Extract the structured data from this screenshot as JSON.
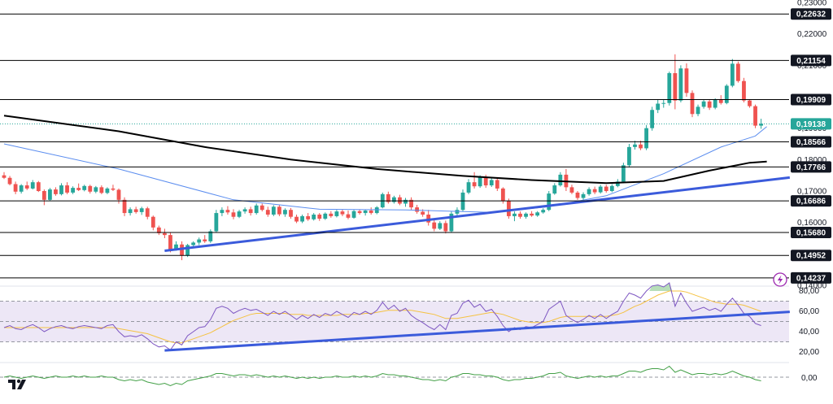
{
  "colors": {
    "up": "#26a69a",
    "down": "#ef5350",
    "ma_fast": "#5b8def",
    "ma_slow": "#000000",
    "trendline": "#3b5bdb",
    "rsi": "#7e57c2",
    "rsi_ma": "#f5c242",
    "rsi_band": "#ede7f6",
    "momentum": "#43a047",
    "level_line": "#000000",
    "price_tag": "#26a69a"
  },
  "price_axis_ticks": [
    "0,23000",
    "0,22000",
    "0,21000",
    "0,20000",
    "0,19000",
    "0,18000",
    "0,17000",
    "0,16000",
    "0,15000",
    "0,14000"
  ],
  "levels": [
    "0,22632",
    "0,21154",
    "0,19909",
    "0,18566",
    "0,17766",
    "0,16686",
    "0,15680",
    "0,14952",
    "0,14237"
  ],
  "current_price": "0,19138",
  "rsi_axis_ticks": [
    "80,00",
    "60,00",
    "40,00",
    "20,00"
  ],
  "momentum_axis_ticks": [
    "0,00"
  ],
  "icons": {
    "logo": "tradingview-logo-icon",
    "alert": "lightning-icon"
  },
  "chart_data": {
    "type": "candlestick",
    "ylim": [
      0.14,
      0.23
    ],
    "candles": [
      [
        0.175,
        0.176,
        0.1738,
        0.1742
      ],
      [
        0.1742,
        0.1748,
        0.1718,
        0.1722
      ],
      [
        0.1722,
        0.173,
        0.169,
        0.1698
      ],
      [
        0.1698,
        0.1722,
        0.1692,
        0.1718
      ],
      [
        0.1718,
        0.173,
        0.1703,
        0.1708
      ],
      [
        0.1708,
        0.1735,
        0.1705,
        0.1728
      ],
      [
        0.1728,
        0.1732,
        0.1697,
        0.17
      ],
      [
        0.17,
        0.1705,
        0.1655,
        0.1672
      ],
      [
        0.1672,
        0.171,
        0.1668,
        0.1705
      ],
      [
        0.1705,
        0.1712,
        0.1685,
        0.169
      ],
      [
        0.169,
        0.1725,
        0.1686,
        0.1718
      ],
      [
        0.1718,
        0.1728,
        0.169,
        0.1695
      ],
      [
        0.1695,
        0.1715,
        0.169,
        0.171
      ],
      [
        0.171,
        0.1724,
        0.17,
        0.1703
      ],
      [
        0.1703,
        0.172,
        0.1699,
        0.1716
      ],
      [
        0.1716,
        0.172,
        0.1692,
        0.1698
      ],
      [
        0.1698,
        0.1716,
        0.1693,
        0.1712
      ],
      [
        0.1712,
        0.1718,
        0.169,
        0.1694
      ],
      [
        0.1694,
        0.1712,
        0.169,
        0.1708
      ],
      [
        0.1708,
        0.172,
        0.17,
        0.1704
      ],
      [
        0.1704,
        0.1708,
        0.166,
        0.1672
      ],
      [
        0.1672,
        0.168,
        0.162,
        0.163
      ],
      [
        0.163,
        0.1648,
        0.1622,
        0.1642
      ],
      [
        0.1642,
        0.165,
        0.1628,
        0.1633
      ],
      [
        0.1633,
        0.165,
        0.1624,
        0.1645
      ],
      [
        0.1645,
        0.165,
        0.161,
        0.1618
      ],
      [
        0.1618,
        0.1622,
        0.1575,
        0.1584
      ],
      [
        0.1584,
        0.159,
        0.156,
        0.1566
      ],
      [
        0.1566,
        0.158,
        0.155,
        0.156
      ],
      [
        0.156,
        0.1568,
        0.1505,
        0.1515
      ],
      [
        0.1515,
        0.154,
        0.151,
        0.153
      ],
      [
        0.153,
        0.154,
        0.148,
        0.1495
      ],
      [
        0.1495,
        0.1532,
        0.149,
        0.1528
      ],
      [
        0.1528,
        0.154,
        0.152,
        0.1536
      ],
      [
        0.1536,
        0.1552,
        0.1528,
        0.1546
      ],
      [
        0.1546,
        0.156,
        0.1535,
        0.154
      ],
      [
        0.154,
        0.1578,
        0.1535,
        0.1572
      ],
      [
        0.1572,
        0.164,
        0.1568,
        0.163
      ],
      [
        0.163,
        0.1648,
        0.162,
        0.164
      ],
      [
        0.164,
        0.1652,
        0.1625,
        0.1632
      ],
      [
        0.1632,
        0.1642,
        0.161,
        0.1618
      ],
      [
        0.1618,
        0.164,
        0.1614,
        0.1635
      ],
      [
        0.1635,
        0.1648,
        0.1628,
        0.1642
      ],
      [
        0.1642,
        0.165,
        0.1622,
        0.163
      ],
      [
        0.163,
        0.166,
        0.1625,
        0.1654
      ],
      [
        0.1654,
        0.166,
        0.1635,
        0.164
      ],
      [
        0.164,
        0.165,
        0.1618,
        0.1625
      ],
      [
        0.1625,
        0.1655,
        0.162,
        0.165
      ],
      [
        0.165,
        0.1655,
        0.162,
        0.1626
      ],
      [
        0.1626,
        0.1645,
        0.1618,
        0.164
      ],
      [
        0.164,
        0.1646,
        0.1612,
        0.1618
      ],
      [
        0.1618,
        0.1625,
        0.1598,
        0.1603
      ],
      [
        0.1603,
        0.1625,
        0.1598,
        0.162
      ],
      [
        0.162,
        0.163,
        0.1605,
        0.161
      ],
      [
        0.161,
        0.163,
        0.1606,
        0.1625
      ],
      [
        0.1625,
        0.163,
        0.1605,
        0.1612
      ],
      [
        0.1612,
        0.1632,
        0.1608,
        0.1628
      ],
      [
        0.1628,
        0.1636,
        0.1615,
        0.162
      ],
      [
        0.162,
        0.164,
        0.1616,
        0.1635
      ],
      [
        0.1635,
        0.1642,
        0.162,
        0.1626
      ],
      [
        0.1626,
        0.1638,
        0.161,
        0.1615
      ],
      [
        0.1615,
        0.164,
        0.1612,
        0.1636
      ],
      [
        0.1636,
        0.1642,
        0.1625,
        0.163
      ],
      [
        0.163,
        0.164,
        0.1622,
        0.1638
      ],
      [
        0.1638,
        0.1648,
        0.1625,
        0.163
      ],
      [
        0.163,
        0.1652,
        0.1626,
        0.1648
      ],
      [
        0.1648,
        0.1695,
        0.1645,
        0.169
      ],
      [
        0.169,
        0.1698,
        0.166,
        0.1665
      ],
      [
        0.1665,
        0.1685,
        0.166,
        0.168
      ],
      [
        0.168,
        0.1688,
        0.1655,
        0.166
      ],
      [
        0.166,
        0.1678,
        0.165,
        0.1672
      ],
      [
        0.1672,
        0.168,
        0.164,
        0.1648
      ],
      [
        0.1648,
        0.1656,
        0.1628,
        0.1634
      ],
      [
        0.1634,
        0.1642,
        0.1618,
        0.1625
      ],
      [
        0.1625,
        0.164,
        0.159,
        0.16
      ],
      [
        0.16,
        0.1612,
        0.1572,
        0.158
      ],
      [
        0.158,
        0.1604,
        0.1576,
        0.1598
      ],
      [
        0.1598,
        0.1606,
        0.1565,
        0.1572
      ],
      [
        0.1572,
        0.1635,
        0.1568,
        0.1628
      ],
      [
        0.1628,
        0.1648,
        0.1622,
        0.164
      ],
      [
        0.164,
        0.1705,
        0.1636,
        0.1695
      ],
      [
        0.1695,
        0.1738,
        0.169,
        0.1728
      ],
      [
        0.1728,
        0.176,
        0.1708,
        0.1715
      ],
      [
        0.1715,
        0.175,
        0.171,
        0.1745
      ],
      [
        0.1745,
        0.1752,
        0.171,
        0.1718
      ],
      [
        0.1718,
        0.174,
        0.1713,
        0.1735
      ],
      [
        0.1735,
        0.1742,
        0.17,
        0.1708
      ],
      [
        0.1708,
        0.1712,
        0.166,
        0.1668
      ],
      [
        0.1668,
        0.1676,
        0.1612,
        0.162
      ],
      [
        0.162,
        0.1635,
        0.1604,
        0.1628
      ],
      [
        0.1628,
        0.1635,
        0.1612,
        0.1618
      ],
      [
        0.1618,
        0.1632,
        0.1612,
        0.1628
      ],
      [
        0.1628,
        0.1636,
        0.1618,
        0.1622
      ],
      [
        0.1622,
        0.1636,
        0.1618,
        0.1632
      ],
      [
        0.1632,
        0.1645,
        0.1628,
        0.164
      ],
      [
        0.164,
        0.17,
        0.1636,
        0.1692
      ],
      [
        0.1692,
        0.1725,
        0.1688,
        0.1718
      ],
      [
        0.1718,
        0.176,
        0.1714,
        0.1752
      ],
      [
        0.1752,
        0.177,
        0.17,
        0.1712
      ],
      [
        0.1712,
        0.172,
        0.169,
        0.1695
      ],
      [
        0.1695,
        0.17,
        0.1672,
        0.1678
      ],
      [
        0.1678,
        0.1696,
        0.1672,
        0.169
      ],
      [
        0.169,
        0.1712,
        0.1685,
        0.1706
      ],
      [
        0.1706,
        0.1714,
        0.169,
        0.1696
      ],
      [
        0.1696,
        0.172,
        0.1692,
        0.1714
      ],
      [
        0.1714,
        0.172,
        0.1695,
        0.17
      ],
      [
        0.17,
        0.1722,
        0.1696,
        0.1716
      ],
      [
        0.1716,
        0.1738,
        0.1712,
        0.173
      ],
      [
        0.173,
        0.179,
        0.1725,
        0.1782
      ],
      [
        0.1782,
        0.185,
        0.1775,
        0.184
      ],
      [
        0.184,
        0.186,
        0.1832,
        0.1848
      ],
      [
        0.1848,
        0.186,
        0.183,
        0.1836
      ],
      [
        0.1836,
        0.191,
        0.183,
        0.19
      ],
      [
        0.19,
        0.1968,
        0.1892,
        0.1958
      ],
      [
        0.1958,
        0.199,
        0.1948,
        0.1978
      ],
      [
        0.1978,
        0.1992,
        0.1965,
        0.198
      ],
      [
        0.198,
        0.208,
        0.1972,
        0.2075
      ],
      [
        0.2075,
        0.2135,
        0.196,
        0.1988
      ],
      [
        0.1988,
        0.21,
        0.1982,
        0.209
      ],
      [
        0.209,
        0.2106,
        0.2,
        0.2012
      ],
      [
        0.2012,
        0.202,
        0.1935,
        0.1945
      ],
      [
        0.1945,
        0.1975,
        0.1938,
        0.1968
      ],
      [
        0.1968,
        0.1992,
        0.1962,
        0.1985
      ],
      [
        0.1985,
        0.199,
        0.1958,
        0.1965
      ],
      [
        0.1965,
        0.1995,
        0.196,
        0.199
      ],
      [
        0.199,
        0.2005,
        0.1975,
        0.198
      ],
      [
        0.198,
        0.204,
        0.1976,
        0.2035
      ],
      [
        0.2035,
        0.212,
        0.203,
        0.2105
      ],
      [
        0.2105,
        0.2112,
        0.2045,
        0.205
      ],
      [
        0.205,
        0.206,
        0.1982,
        0.1988
      ],
      [
        0.1988,
        0.1992,
        0.1965,
        0.197
      ],
      [
        0.197,
        0.1975,
        0.19,
        0.1908
      ],
      [
        0.1908,
        0.193,
        0.1898,
        0.1914
      ]
    ],
    "ma_fast": [
      [
        0,
        0.185
      ],
      [
        20,
        0.177
      ],
      [
        40,
        0.1672
      ],
      [
        55,
        0.1642
      ],
      [
        70,
        0.164
      ],
      [
        85,
        0.1632
      ],
      [
        95,
        0.165
      ],
      [
        105,
        0.1685
      ],
      [
        115,
        0.1755
      ],
      [
        125,
        0.184
      ],
      [
        131,
        0.1875
      ],
      [
        133,
        0.1905
      ]
    ],
    "ma_slow": [
      [
        0,
        0.194
      ],
      [
        20,
        0.189
      ],
      [
        35,
        0.184
      ],
      [
        50,
        0.18
      ],
      [
        65,
        0.177
      ],
      [
        80,
        0.1748
      ],
      [
        92,
        0.1735
      ],
      [
        105,
        0.1725
      ],
      [
        115,
        0.1732
      ],
      [
        123,
        0.1765
      ],
      [
        130,
        0.179
      ],
      [
        133,
        0.1794
      ]
    ],
    "trendline": [
      [
        28,
        0.151
      ],
      [
        137,
        0.1743
      ]
    ],
    "rsi": {
      "ylim": [
        20,
        90
      ],
      "band": [
        30,
        70
      ],
      "values": [
        44,
        46,
        43,
        42,
        45,
        47,
        44,
        40,
        43,
        45,
        46,
        44,
        43,
        45,
        46,
        45,
        44,
        43,
        46,
        47,
        40,
        35,
        36,
        35,
        37,
        33,
        28,
        25,
        26,
        22,
        30,
        27,
        36,
        40,
        44,
        45,
        52,
        63,
        65,
        63,
        58,
        61,
        63,
        61,
        62,
        59,
        56,
        60,
        57,
        60,
        56,
        52,
        56,
        53,
        57,
        54,
        58,
        56,
        60,
        57,
        54,
        59,
        57,
        60,
        57,
        61,
        69,
        62,
        66,
        60,
        63,
        56,
        52,
        49,
        45,
        42,
        47,
        42,
        56,
        58,
        68,
        71,
        64,
        67,
        60,
        62,
        55,
        46,
        40,
        44,
        42,
        45,
        44,
        47,
        50,
        62,
        66,
        70,
        56,
        52,
        49,
        52,
        56,
        53,
        57,
        53,
        57,
        60,
        70,
        78,
        76,
        73,
        80,
        85,
        86,
        84,
        88,
        65,
        78,
        68,
        60,
        62,
        64,
        61,
        63,
        60,
        67,
        73,
        66,
        58,
        55,
        48,
        46
      ],
      "ma": [
        44,
        44,
        44,
        44,
        44,
        44,
        44,
        44,
        44,
        44,
        44,
        44,
        44,
        44,
        44,
        44,
        44,
        44,
        44,
        44,
        43,
        42,
        41,
        40,
        39,
        38,
        36,
        34,
        32,
        30,
        29,
        29,
        31,
        33,
        35,
        37,
        39,
        42,
        45,
        48,
        51,
        53,
        55,
        57,
        58,
        58,
        58,
        58,
        58,
        58,
        57,
        57,
        57,
        56,
        56,
        56,
        56,
        56,
        56,
        57,
        57,
        57,
        57,
        58,
        58,
        59,
        60,
        61,
        61,
        61,
        61,
        61,
        60,
        59,
        58,
        57,
        55,
        53,
        53,
        53,
        54,
        55,
        56,
        57,
        58,
        59,
        58,
        57,
        55,
        53,
        51,
        50,
        49,
        49,
        49,
        50,
        52,
        54,
        55,
        55,
        55,
        55,
        55,
        55,
        55,
        55,
        56,
        57,
        59,
        62,
        65,
        67,
        70,
        73,
        76,
        78,
        80,
        80,
        80,
        79,
        77,
        75,
        73,
        71,
        69,
        68,
        67,
        67,
        67,
        66,
        64,
        62,
        60
      ]
    },
    "rsi_trendline": [
      [
        28,
        21.5
      ],
      [
        137,
        59.5
      ]
    ],
    "momentum": {
      "ylim": [
        -0.01,
        0.01
      ],
      "values": [
        0.0,
        0.001,
        0.0,
        -0.001,
        0.0,
        0.001,
        0.0,
        -0.001,
        0.0,
        0.001,
        0.0,
        0.0,
        0.001,
        0.0,
        0.001,
        0.0,
        0.0,
        0.001,
        0.0,
        0.0,
        -0.002,
        -0.003,
        -0.002,
        -0.003,
        -0.002,
        -0.004,
        -0.005,
        -0.006,
        -0.005,
        -0.007,
        -0.005,
        -0.006,
        -0.003,
        -0.002,
        -0.001,
        0.0,
        0.001,
        0.003,
        0.003,
        0.002,
        0.001,
        0.002,
        0.002,
        0.001,
        0.002,
        0.001,
        0.0,
        0.001,
        0.0,
        0.001,
        0.0,
        -0.001,
        0.0,
        -0.001,
        0.0,
        -0.001,
        0.0,
        0.0,
        0.001,
        0.0,
        0.0,
        0.001,
        0.0,
        0.001,
        0.0,
        0.001,
        0.003,
        0.002,
        0.002,
        0.001,
        0.001,
        0.0,
        -0.001,
        -0.002,
        -0.002,
        -0.003,
        -0.002,
        -0.003,
        0.0,
        0.001,
        0.003,
        0.003,
        0.002,
        0.002,
        0.001,
        0.001,
        0.0,
        -0.002,
        -0.003,
        -0.002,
        -0.002,
        -0.001,
        -0.001,
        0.0,
        0.001,
        0.003,
        0.003,
        0.004,
        0.001,
        0.0,
        -0.001,
        0.0,
        0.001,
        0.0,
        0.001,
        0.0,
        0.001,
        0.001,
        0.003,
        0.005,
        0.005,
        0.004,
        0.006,
        0.007,
        0.007,
        0.006,
        0.009,
        0.004,
        0.006,
        0.004,
        0.002,
        0.003,
        0.003,
        0.002,
        0.003,
        0.002,
        0.003,
        0.005,
        0.003,
        0.001,
        0.0,
        -0.002,
        -0.003
      ]
    }
  }
}
